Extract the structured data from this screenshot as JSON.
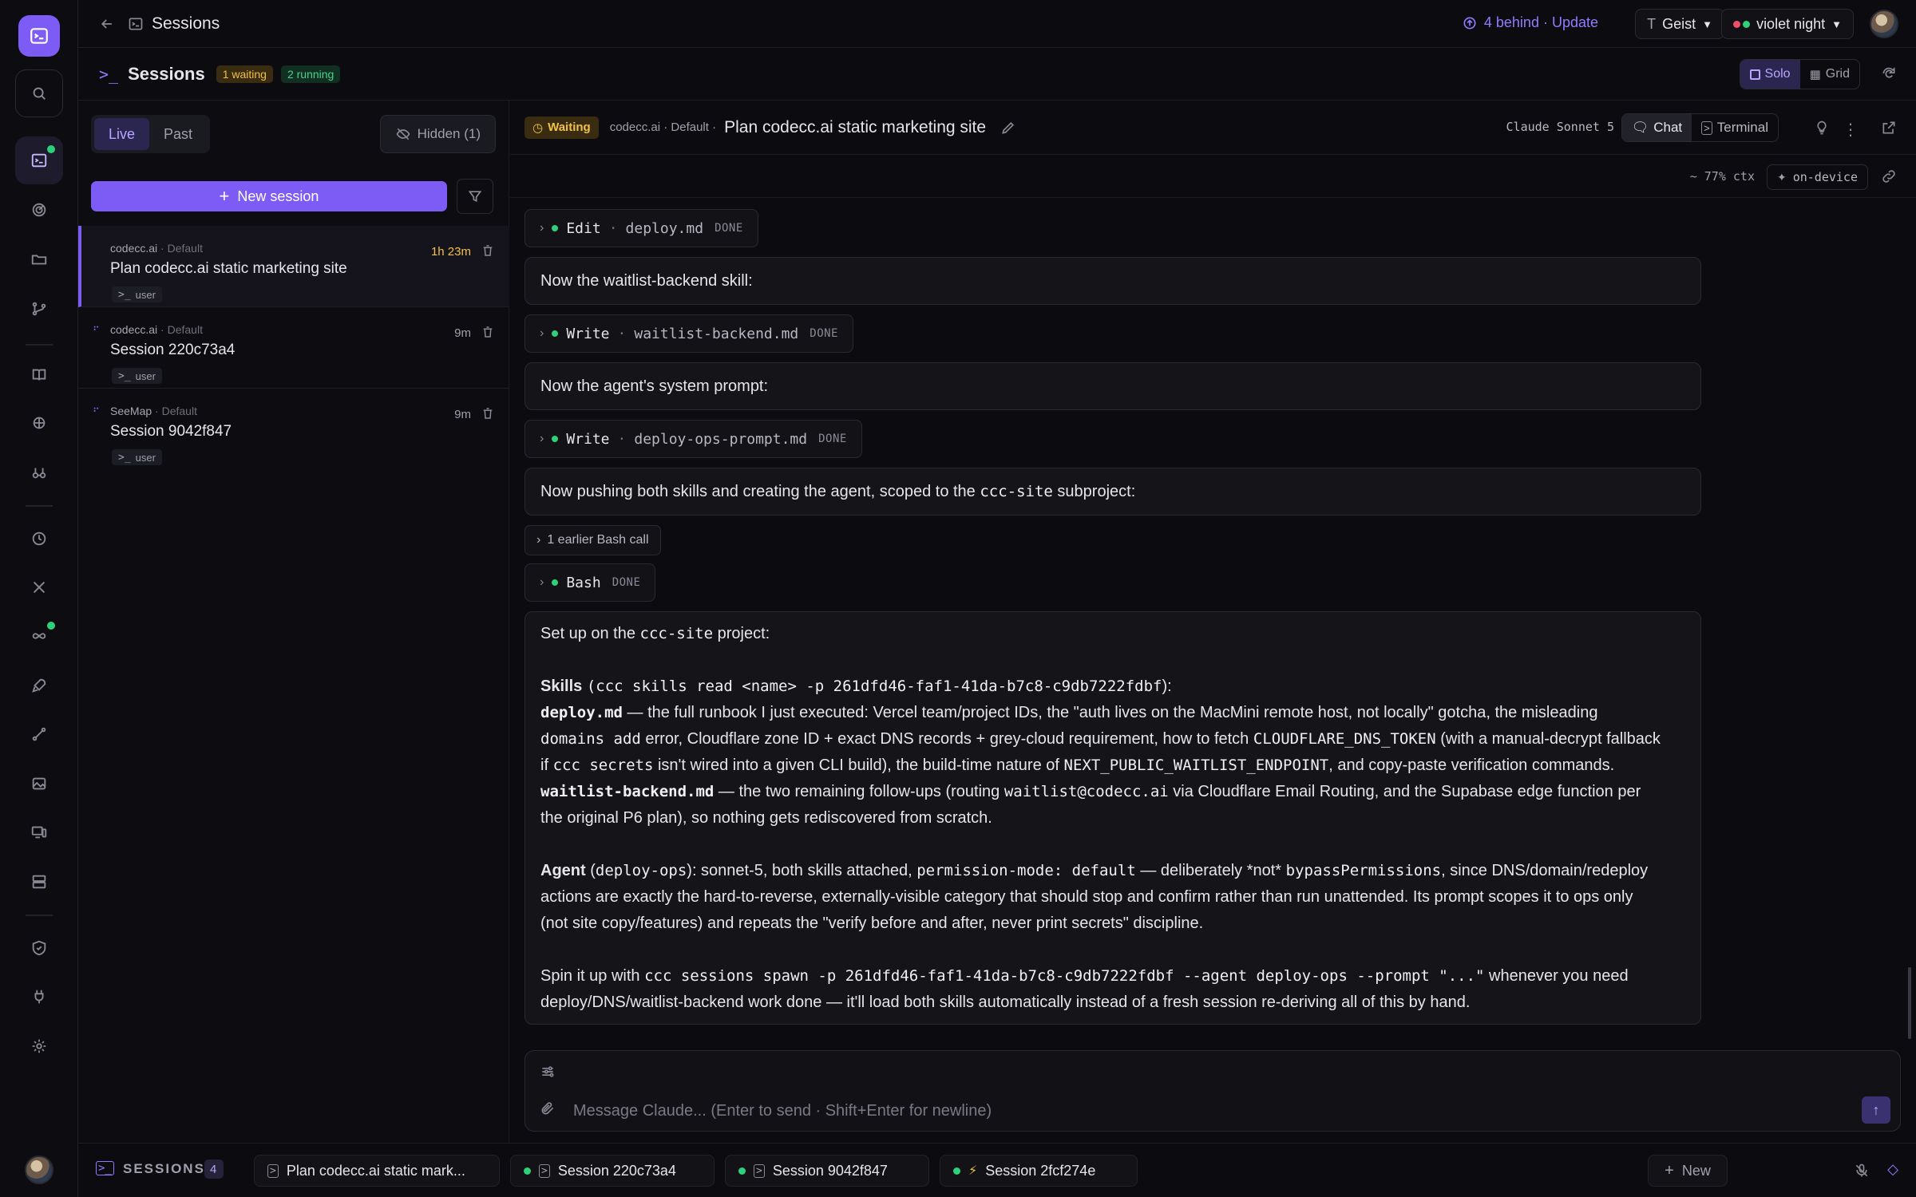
{
  "topbar": {
    "title": "Sessions",
    "update_text": "4 behind · Update",
    "font_label": "Geist",
    "theme_label": "violet night"
  },
  "subheader": {
    "title": "Sessions",
    "waiting_badge": "1 waiting",
    "running_badge": "2 running",
    "solo_label": "Solo",
    "grid_label": "Grid"
  },
  "sidebar": {
    "tab_live": "Live",
    "tab_past": "Past",
    "hidden_label": "Hidden (1)",
    "new_session_label": "New session",
    "sessions": [
      {
        "project": "codecc.ai",
        "workspace": "· Default",
        "name": "Plan codecc.ai static marketing site",
        "tag": "user",
        "time": "1h 23m"
      },
      {
        "project": "codecc.ai",
        "workspace": "· Default",
        "name": "Session 220c73a4",
        "tag": "user",
        "time": "9m"
      },
      {
        "project": "SeeMap",
        "workspace": "· Default",
        "name": "Session 9042f847",
        "tag": "user",
        "time": "9m"
      }
    ]
  },
  "main": {
    "status": "Waiting",
    "breadcrumb": "codecc.ai · Default ·",
    "session_title": "Plan codecc.ai static marketing site",
    "model": "Claude Sonnet 5",
    "chat_label": "Chat",
    "terminal_label": "Terminal",
    "ctx_text": "~ 77% ctx",
    "on_device_label": "on-device"
  },
  "feed": {
    "tool1": {
      "name": "Edit",
      "sep": "·",
      "file": "deploy.md",
      "status": "DONE"
    },
    "msg1": "Now the waitlist-backend skill:",
    "tool2": {
      "name": "Write",
      "sep": "·",
      "file": "waitlist-backend.md",
      "status": "DONE"
    },
    "msg2": "Now the agent's system prompt:",
    "tool3": {
      "name": "Write",
      "sep": "·",
      "file": "deploy-ops-prompt.md",
      "status": "DONE"
    },
    "msg3": {
      "pre": "Now pushing both skills and creating the agent, scoped to the ",
      "code": "ccc-site",
      "post": " subproject:"
    },
    "earlier": "1 earlier Bash call",
    "tool4": {
      "name": "Bash",
      "status": "DONE"
    },
    "final": {
      "l1_pre": "Set up on the ",
      "l1_code": "ccc-site",
      "l1_post": " project:",
      "skills_b": "Skills",
      "skills_code": "(ccc skills read <name> -p 261dfd46-faf1-41da-b7c8-c9db7222fdbf",
      "skills_post": "):",
      "deploy_b": "deploy.md",
      "deploy_t1": " — the full runbook I just executed: Vercel team/project IDs, the \"auth lives on the MacMini remote host, not locally\" gotcha, the misleading",
      "deploy_code1": "domains add",
      "deploy_t2": " error, Cloudflare zone ID + exact DNS records + grey-cloud requirement, how to fetch ",
      "deploy_code2": "CLOUDFLARE_DNS_TOKEN",
      "deploy_t3": " (with a manual-decrypt fallback",
      "deploy_t4": "if ",
      "deploy_code3": "ccc secrets",
      "deploy_t5": " isn't wired into a given CLI build), the build-time nature of ",
      "deploy_code4": "NEXT_PUBLIC_WAITLIST_ENDPOINT",
      "deploy_t6": ", and copy-paste verification commands.",
      "wait_b": "waitlist-backend.md",
      "wait_t1": " — the two remaining follow-ups (routing ",
      "wait_code": "waitlist@codecc.ai",
      "wait_t2": " via Cloudflare Email Routing, and the Supabase edge function per",
      "wait_t3": "the original P6 plan), so nothing gets rediscovered from scratch.",
      "agent_b": "Agent",
      "agent_t1": " (",
      "agent_code1": "deploy-ops",
      "agent_t2": "): sonnet-5, both skills attached, ",
      "agent_code2": "permission-mode: default",
      "agent_t3": " — deliberately *not* ",
      "agent_code3": "bypassPermissions",
      "agent_t4": ", since DNS/domain/redeploy",
      "agent_t5": "actions are exactly the hard-to-reverse, externally-visible category that should stop and confirm rather than run unattended. Its prompt scopes it to ops only",
      "agent_t6": "(not site copy/features) and repeats the \"verify before and after, never print secrets\" discipline.",
      "spin_t1": "Spin it up with ",
      "spin_code": "ccc sessions spawn -p 261dfd46-faf1-41da-b7c8-c9db7222fdbf --agent deploy-ops --prompt \"...\"",
      "spin_t2": " whenever you need",
      "spin_t3": "deploy/DNS/waitlist-backend work done — it'll load both skills automatically instead of a fresh session re-deriving all of this by hand."
    }
  },
  "composer": {
    "placeholder": "Message Claude... (Enter to send · Shift+Enter for newline)"
  },
  "bottombar": {
    "label": "SESSIONS",
    "count": "4",
    "tabs": [
      "Plan codecc.ai static mark...",
      "Session 220c73a4",
      "Session 9042f847",
      "Session 2fcf274e"
    ],
    "new_label": "New"
  }
}
